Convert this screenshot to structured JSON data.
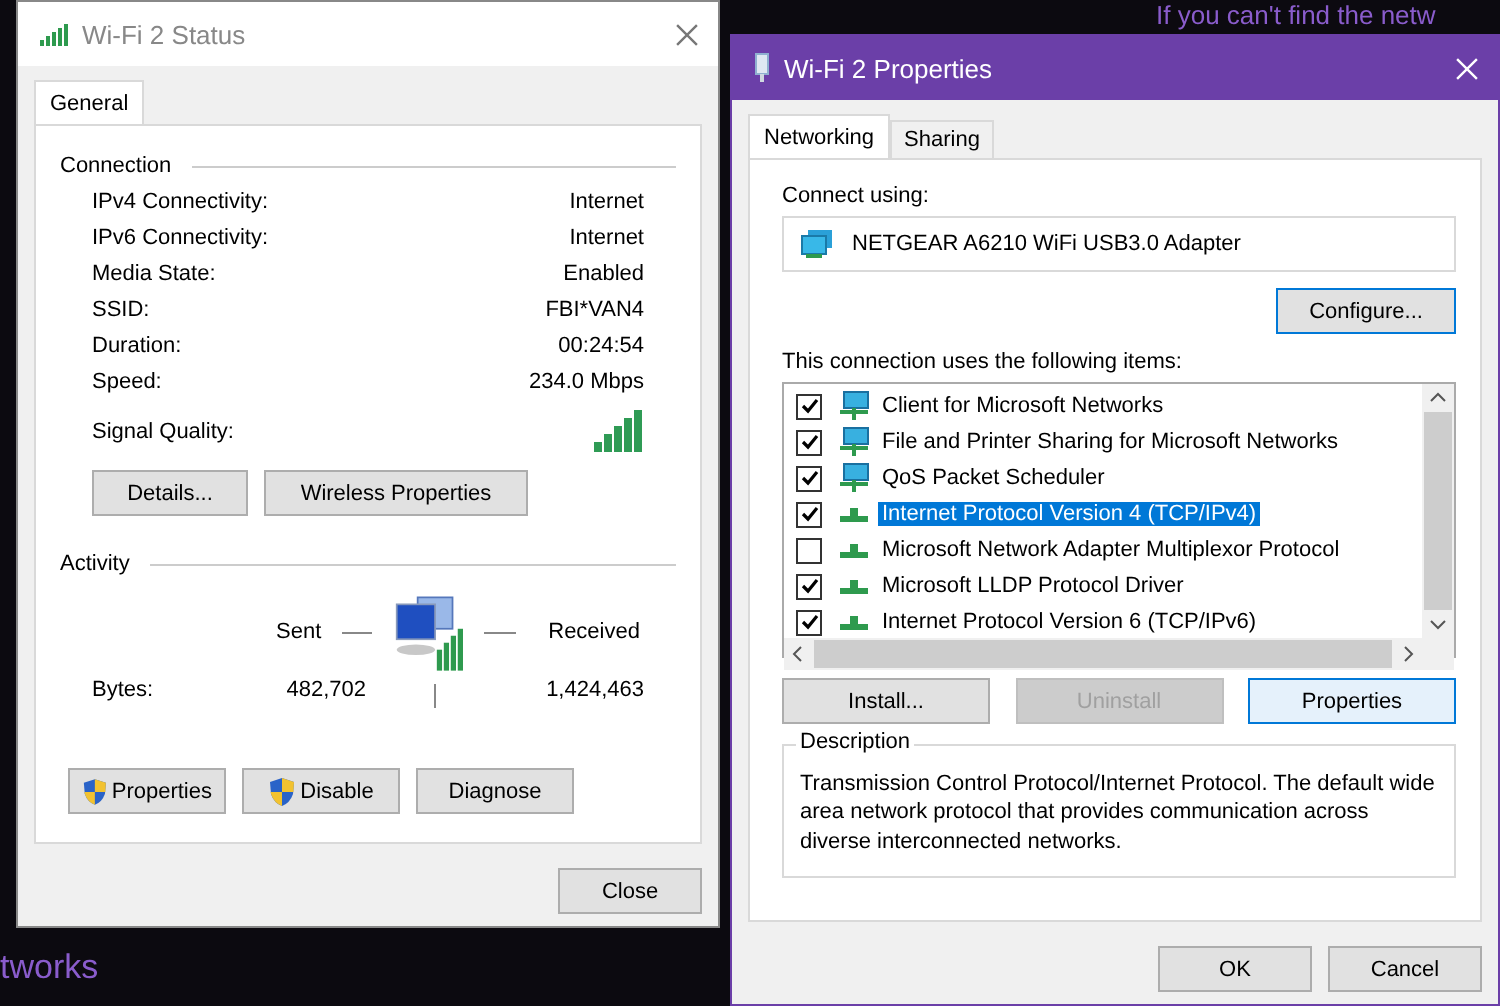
{
  "backdrop": {
    "top_text": "If you can't find the netw",
    "bottom_text": "tworks"
  },
  "status_window": {
    "title": "Wi-Fi 2 Status",
    "tabs": [
      {
        "label": "General",
        "selected": true
      }
    ],
    "connection": {
      "heading": "Connection",
      "rows": [
        {
          "label": "IPv4 Connectivity:",
          "value": "Internet"
        },
        {
          "label": "IPv6 Connectivity:",
          "value": "Internet"
        },
        {
          "label": "Media State:",
          "value": "Enabled"
        },
        {
          "label": "SSID:",
          "value": "FBI*VAN4"
        },
        {
          "label": "Duration:",
          "value": "00:24:54"
        },
        {
          "label": "Speed:",
          "value": "234.0 Mbps"
        }
      ],
      "signal_label": "Signal Quality:"
    },
    "buttons": [
      "Details...",
      "Wireless Properties"
    ],
    "activity": {
      "heading": "Activity",
      "sent_label": "Sent",
      "received_label": "Received",
      "bytes_label": "Bytes:",
      "sent": "482,702",
      "received": "1,424,463"
    },
    "action_buttons": [
      {
        "label": "Properties",
        "shield": true
      },
      {
        "label": "Disable",
        "shield": true
      },
      {
        "label": "Diagnose",
        "shield": false
      }
    ],
    "close": "Close"
  },
  "properties_window": {
    "title": "Wi-Fi 2 Properties",
    "tabs": [
      {
        "label": "Networking",
        "selected": true
      },
      {
        "label": "Sharing",
        "selected": false
      }
    ],
    "connect_label": "Connect using:",
    "adapter": "NETGEAR A6210 WiFi USB3.0 Adapter",
    "configure": "Configure...",
    "items_label": "This connection uses the following items:",
    "items": [
      {
        "label": "Client for Microsoft Networks",
        "checked": true,
        "selected": false,
        "kind": "client"
      },
      {
        "label": "File and Printer Sharing for Microsoft Networks",
        "checked": true,
        "selected": false,
        "kind": "client"
      },
      {
        "label": "QoS Packet Scheduler",
        "checked": true,
        "selected": false,
        "kind": "client"
      },
      {
        "label": "Internet Protocol Version 4 (TCP/IPv4)",
        "checked": true,
        "selected": true,
        "kind": "protocol"
      },
      {
        "label": "Microsoft Network Adapter Multiplexor Protocol",
        "checked": false,
        "selected": false,
        "kind": "protocol"
      },
      {
        "label": "Microsoft LLDP Protocol Driver",
        "checked": true,
        "selected": false,
        "kind": "protocol"
      },
      {
        "label": "Internet Protocol Version 6 (TCP/IPv6)",
        "checked": true,
        "selected": false,
        "kind": "protocol"
      }
    ],
    "buttons": [
      {
        "label": "Install...",
        "disabled": false
      },
      {
        "label": "Uninstall",
        "disabled": true
      },
      {
        "label": "Properties",
        "disabled": false
      }
    ],
    "description_heading": "Description",
    "description": "Transmission Control Protocol/Internet Protocol. The default wide area network protocol that provides communication across diverse interconnected networks.",
    "ok": "OK",
    "cancel": "Cancel"
  }
}
